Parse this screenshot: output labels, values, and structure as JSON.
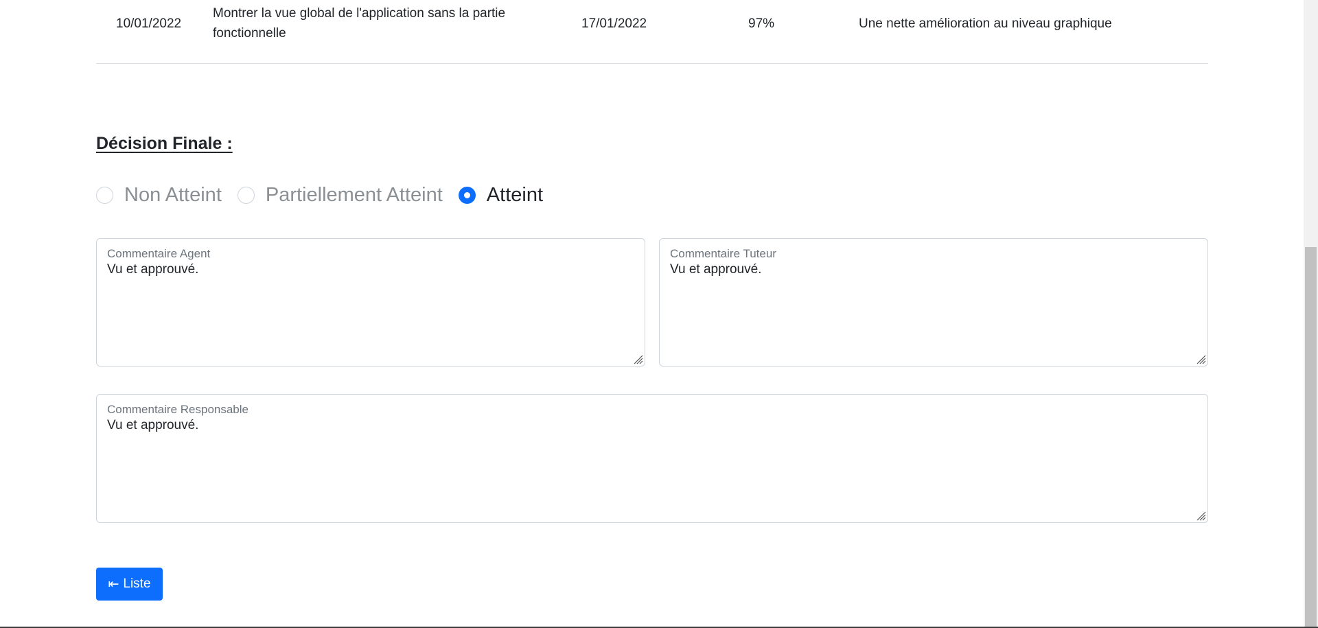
{
  "table_row": {
    "date_start": "10/01/2022",
    "description": "Montrer la vue global de l'application sans la partie fonctionnelle",
    "date_end": "17/01/2022",
    "percent": "97%",
    "comment": "Une nette amélioration au niveau graphique"
  },
  "decision": {
    "title": "Décision Finale :",
    "options": [
      {
        "label": "Non Atteint",
        "checked": false
      },
      {
        "label": "Partiellement Atteint",
        "checked": false
      },
      {
        "label": "Atteint",
        "checked": true
      }
    ]
  },
  "comments": {
    "agent": {
      "label": "Commentaire Agent",
      "value": "Vu et approuvé."
    },
    "tuteur": {
      "label": "Commentaire Tuteur",
      "value": "Vu et approuvé."
    },
    "responsable": {
      "label": "Commentaire Responsable",
      "value": "Vu et approuvé."
    }
  },
  "buttons": {
    "liste_label": "Liste",
    "liste_icon": "arrow-left-to-line-icon"
  },
  "colors": {
    "primary": "#0d6efd",
    "border": "#ced4da",
    "muted_text": "#6c757d"
  }
}
